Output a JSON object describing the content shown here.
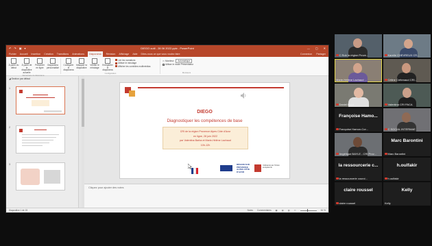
{
  "ppt": {
    "window_title": "DIEGO outil - 28 06 2022.pptx - PowerPoint",
    "quick_access": [
      "↶",
      "↷",
      "▣",
      "▾"
    ],
    "window_controls": [
      "—",
      "▢",
      "✕"
    ],
    "menu_tabs": [
      "Fichier",
      "Accueil",
      "Insertion",
      "Création",
      "Transitions",
      "Animations",
      "Diaporama",
      "Révision",
      "Affichage",
      "Aide"
    ],
    "active_tab_index": 6,
    "search_hint": "Dites-nous ce que vous voulez faire",
    "menu_right": [
      "Connexion",
      "Partager"
    ],
    "ribbon_groups": [
      {
        "caption": "Démarrage du diaporama",
        "items": [
          "À partir du début",
          "À partir de la diapositive actuelle",
          "Présenter en ligne",
          "Diaporama personnalisé"
        ]
      },
      {
        "caption": "Configuration",
        "items": [
          "Configurer le diaporama",
          "Masquer la diapositive",
          "Vérifier le minutage",
          "Enregistrer le diaporama"
        ]
      }
    ],
    "checkboxes": [
      {
        "label": "Lire les narrations",
        "checked": true
      },
      {
        "label": "Utiliser le minutage",
        "checked": true
      },
      {
        "label": "Afficher les contrôles multimédias",
        "checked": true
      }
    ],
    "monitor": {
      "label": "Moniteur :",
      "value": "Automatique",
      "presenter_view": "Utiliser le mode Présentateur",
      "caption": "Moniteurs"
    },
    "section_label": "Section par défaut",
    "slide_numbers": [
      "1",
      "2",
      "3"
    ],
    "slide": {
      "title": "DIEGO",
      "subtitle": "Diagnostiquer les compétences de base",
      "box_lines": [
        "CRI de la région Provence Alpes Côte d'Azur",
        "en ligne, 28 juin 2022",
        "par Valentina Barba et Marie-Hélène Lachaud",
        "10h-12h"
      ],
      "partner_text": "RÉGION SUD PROVENCE ALPES CÔTE D'AZUR",
      "partner_note": "Cofinancé par l'Union européenne"
    },
    "notes_placeholder": "Cliquez pour ajouter des notes",
    "status_left": "Diapositive 1 de 15",
    "status_right": [
      "Notes",
      "Commentaires"
    ],
    "zoom": "61 %"
  },
  "participants": [
    {
      "big": "",
      "small": "C Rob la région Prove...",
      "video": true
    },
    {
      "big": "",
      "small": "Karelle CHEVREUX CR...",
      "video": true
    },
    {
      "big": "",
      "small": "Marie-Hélène Lachaud ...",
      "video": true,
      "active": true
    },
    {
      "big": "",
      "small": "Céline Crétenaud CRI...",
      "video": true
    },
    {
      "big": "",
      "small": "Daniel Bigot",
      "video": true
    },
    {
      "big": "",
      "small": "Valentina CRI PACA",
      "video": true
    },
    {
      "big": "Françoise Hamo...",
      "small": "Françoise Hamon-Cor...",
      "video": false
    },
    {
      "big": "",
      "small": "C SOCIAL INTERMAE",
      "video": true
    },
    {
      "big": "",
      "small": "Angélique BAYLE - CRI Prov...",
      "video": true
    },
    {
      "big": "Marc Barontini",
      "small": "Marc Barontini",
      "video": false
    },
    {
      "big": "la ressourcerie c...",
      "small": "la ressourcerie courci...",
      "video": false
    },
    {
      "big": "h.oulfakir",
      "small": "h.oulfakir",
      "video": false
    },
    {
      "big": "claire roussel",
      "small": "claire roussel",
      "video": false
    },
    {
      "big": "Kelly",
      "small": "Kelly",
      "video": false
    }
  ]
}
